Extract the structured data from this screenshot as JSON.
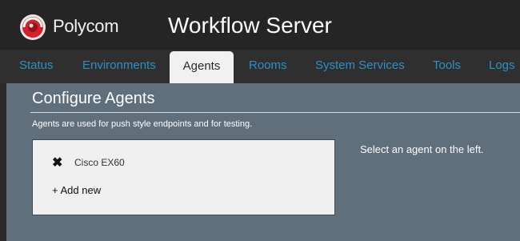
{
  "header": {
    "brand": "Polycom",
    "app_title": "Workflow Server",
    "brand_color": "#d6212b"
  },
  "tabs": [
    {
      "label": "Status"
    },
    {
      "label": "Environments"
    },
    {
      "label": "Agents",
      "active": true
    },
    {
      "label": "Rooms"
    },
    {
      "label": "System Services"
    },
    {
      "label": "Tools"
    },
    {
      "label": "Logs"
    }
  ],
  "page": {
    "title": "Configure Agents",
    "description": "Agents are used for push style endpoints and for testing."
  },
  "agents": {
    "items": [
      {
        "name": "Cisco EX60",
        "icon": "x-icon"
      }
    ],
    "add_label": "+ Add new"
  },
  "detail": {
    "hint": "Select an agent on the left."
  }
}
